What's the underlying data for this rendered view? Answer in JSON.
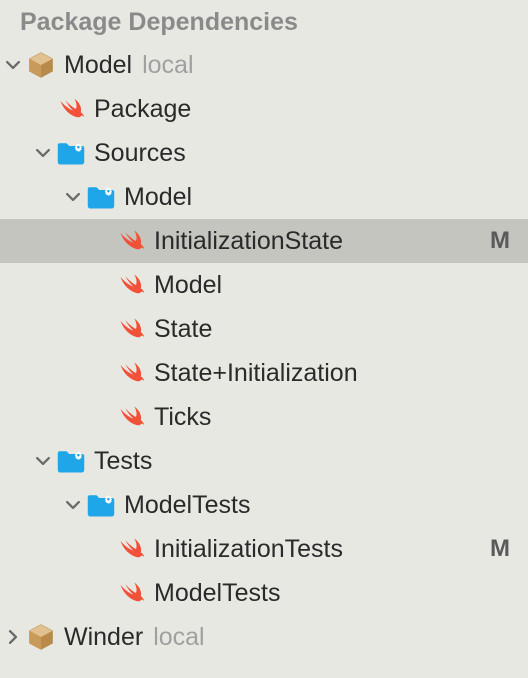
{
  "section_title": "Package Dependencies",
  "colors": {
    "swift": "#F05138",
    "package": "#C99B5A",
    "folder": "#1FA6E8",
    "gear": "#ffffff",
    "badge": "#5a5a5a"
  },
  "badges": {
    "modified": "M"
  },
  "tree": {
    "model_pkg": {
      "name": "Model",
      "tag": "local",
      "expanded": true
    },
    "winder_pkg": {
      "name": "Winder",
      "tag": "local",
      "expanded": false
    },
    "package_file": "Package",
    "sources_folder": "Sources",
    "model_folder": "Model",
    "sources_model_files": {
      "init_state": "InitializationState",
      "model": "Model",
      "state": "State",
      "state_init": "State+Initialization",
      "ticks": "Ticks"
    },
    "tests_folder": "Tests",
    "modeltests_folder": "ModelTests",
    "tests_files": {
      "init_tests": "InitializationTests",
      "model_tests": "ModelTests"
    }
  }
}
